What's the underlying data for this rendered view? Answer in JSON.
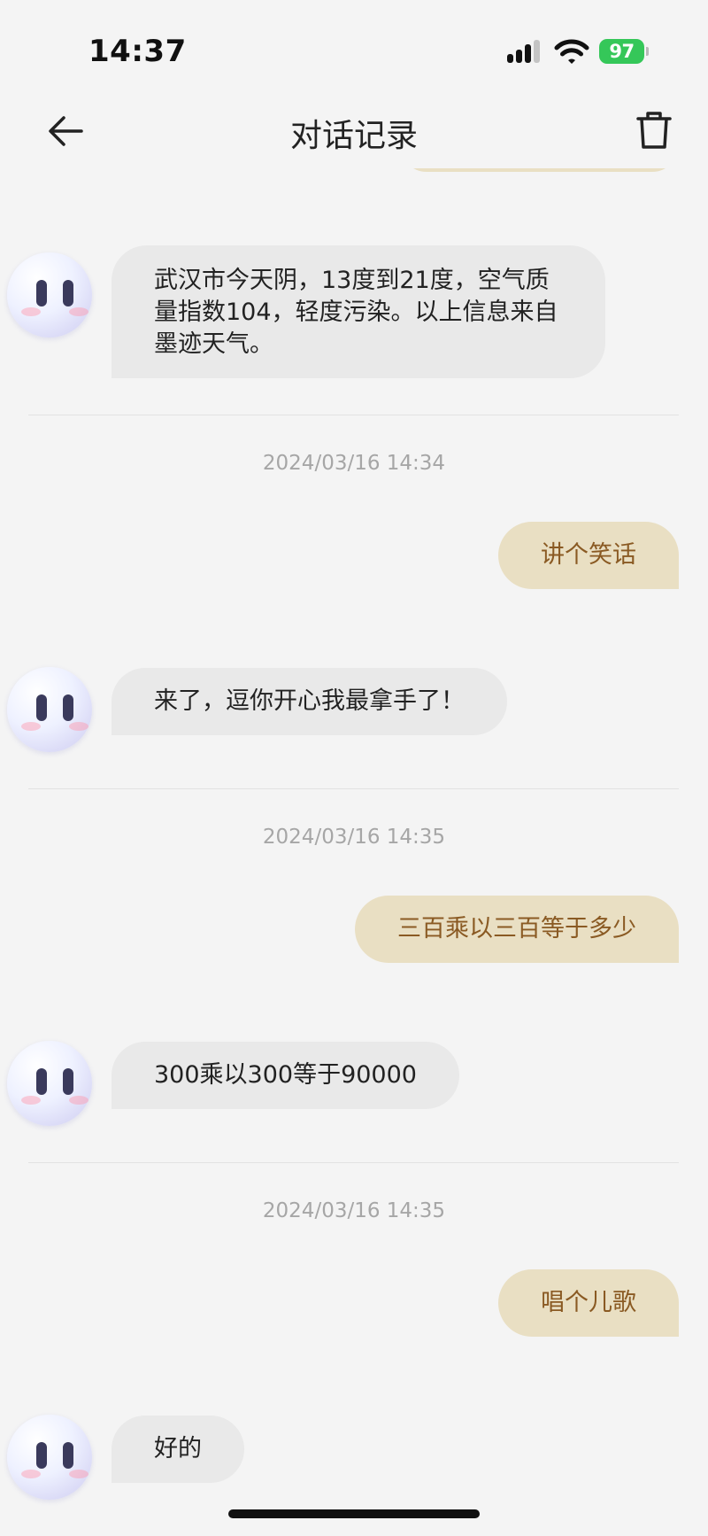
{
  "status_bar": {
    "time": "14:37",
    "battery": "97",
    "icons": [
      "signal-icon",
      "wifi-icon",
      "battery-icon"
    ]
  },
  "nav": {
    "title": "对话记录",
    "back_icon": "arrow-left-icon",
    "delete_icon": "trash-icon"
  },
  "messages": [
    {
      "role": "bot",
      "text": "武汉市今天阴，13度到21度，空气质量指数104，轻度污染。以上信息来自墨迹天气。"
    },
    {
      "role": "timestamp",
      "text": "2024/03/16 14:34"
    },
    {
      "role": "user",
      "text": "讲个笑话"
    },
    {
      "role": "bot",
      "text": "来了，逗你开心我最拿手了！"
    },
    {
      "role": "timestamp",
      "text": "2024/03/16 14:35"
    },
    {
      "role": "user",
      "text": "三百乘以三百等于多少"
    },
    {
      "role": "bot",
      "text": "300乘以300等于90000"
    },
    {
      "role": "timestamp",
      "text": "2024/03/16 14:35"
    },
    {
      "role": "user",
      "text": "唱个儿歌"
    },
    {
      "role": "bot",
      "text": "好的"
    }
  ],
  "colors": {
    "background": "#f4f4f4",
    "user_bubble": "#e9dfc3",
    "user_text": "#8a5a23",
    "bot_bubble": "#e9e9e9",
    "battery": "#35c759"
  }
}
